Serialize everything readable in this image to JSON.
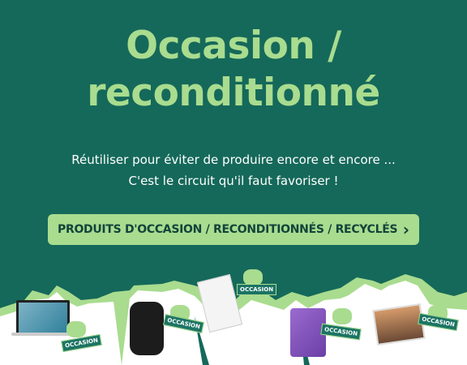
{
  "hero": {
    "title_line1": "Occasion /",
    "title_line2": "reconditionné",
    "subtitle_line1": "Réutiliser pour éviter de produire encore et encore ...",
    "subtitle_line2": "C'est le circuit qu'il faut favoriser !"
  },
  "cta": {
    "label": "PRODUITS D'OCCASION / RECONDITIONNÉS / RECYCLÉS",
    "icon": "chevron-right-icon",
    "chevron": "›"
  },
  "badges": [
    "OCCASION",
    "OCCASION",
    "OCCASION",
    "OCCASION",
    "OCCASION"
  ],
  "colors": {
    "background": "#15695a",
    "accent": "#a9dc8f",
    "cta_text": "#12443a"
  }
}
